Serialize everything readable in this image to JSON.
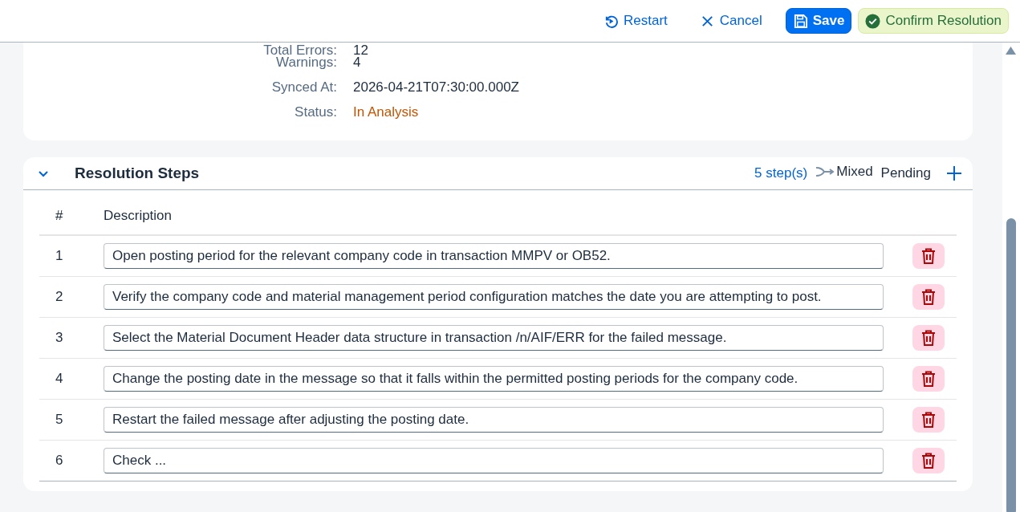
{
  "toolbar": {
    "buttons": [
      {
        "kind": "restart",
        "label": "Restart"
      },
      {
        "kind": "cancel",
        "label": "Cancel"
      },
      {
        "kind": "save",
        "label": "Save"
      },
      {
        "kind": "confirm",
        "label": "Confirm Resolution"
      }
    ]
  },
  "summary": {
    "fields": [
      {
        "label": "Total Errors:",
        "value": "12",
        "kind": "plain"
      },
      {
        "label": "Warnings:",
        "value": "4",
        "kind": "plain"
      },
      {
        "label": "Synced At:",
        "value": "2026-04-21T07:30:00.000Z",
        "kind": "plain"
      },
      {
        "label": "Status:",
        "value": "In Analysis",
        "kind": "status"
      }
    ]
  },
  "steps_panel": {
    "title": "Resolution Steps",
    "expanded": true,
    "count": "5 step(s)",
    "mode": "Mixed",
    "state": "Pending",
    "columns": [
      "#",
      "Description"
    ],
    "rows": [
      {
        "number": "1",
        "description": "Open posting period for the relevant company code in transaction MMPV or OB52."
      },
      {
        "number": "2",
        "description": "Verify the company code and material management period configuration matches the date you are attempting to post."
      },
      {
        "number": "3",
        "description": "Select the Material Document Header data structure in transaction /n/AIF/ERR for the failed message."
      },
      {
        "number": "4",
        "description": "Change the posting date in the message so that it falls within the permitted posting periods for the company code."
      },
      {
        "number": "5",
        "description": "Restart the failed message after adjusting the posting date."
      },
      {
        "number": "6",
        "description": "Check ..."
      }
    ]
  }
}
